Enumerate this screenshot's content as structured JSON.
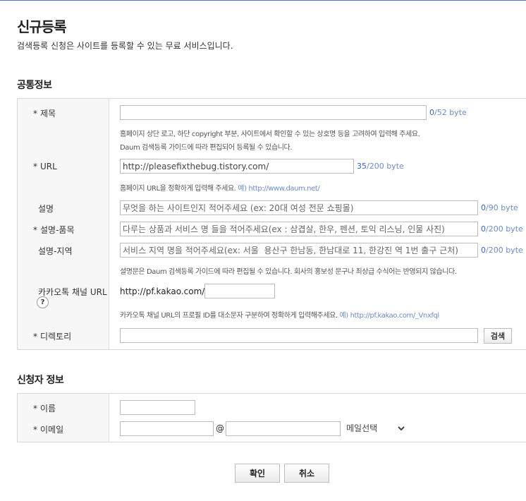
{
  "page": {
    "title": "신규등록",
    "description": "검색등록 신청은 사이트를 등록할 수 있는 무료 서비스입니다."
  },
  "common": {
    "section_title": "공통정보",
    "title_field": {
      "label": "제목",
      "value": "",
      "count": "0",
      "limit": "/52 byte"
    },
    "title_help_1": "홈페이지 상단 로고, 하단 copyright 부분, 사이트에서 확인할 수 있는 상호명 등을 고려하여 입력해 주세요.",
    "title_help_2": "Daum 검색등록 가이드에 따라 편집되어 등록될 수 있습니다.",
    "url_field": {
      "label": "URL",
      "value": "http://pleasefixthebug.tistory.com/",
      "count": "35",
      "limit": "/200 byte"
    },
    "url_help": "홈페이지 URL을 정확하게 입력해 주세요.",
    "url_help_example": "예) http://www.daum.net/",
    "desc_field": {
      "label": "설명",
      "placeholder": "무엇을 하는 사이트인지 적어주세요 (ex: 20대 여성 전문 쇼핑몰)",
      "count": "0",
      "limit": "/90 byte"
    },
    "desc_product_field": {
      "label": "설명-품목",
      "placeholder": "다루는 상품과 서비스 명 들을 적어주세요(ex : 삼겹살, 한우, 펜션, 토익 리스닝, 인물 사진)",
      "count": "0",
      "limit": "/200 byte"
    },
    "desc_region_field": {
      "label": "설명-지역",
      "placeholder": "서비스 지역 명을 적어주세요(ex: 서울  용산구 한남동, 한남대로 11, 한강진 역 1번 출구 근처)",
      "count": "0",
      "limit": "/200 byte"
    },
    "desc_help": "설명문은 Daum 검색등록 가이드에 따라 편집될 수 있습니다. 회사의 홍보성 문구나 최상급 수식어는 반영되지 않습니다.",
    "kakao_field": {
      "label": "카카오톡 채널 URL",
      "help_glyph": "?",
      "prefix": "http://pf.kakao.com/",
      "value": ""
    },
    "kakao_help": "카카오톡 채널 URL의 프로필 ID를 대소문자 구분하여 정확하게 입력해주세요.",
    "kakao_help_example": "예) http://pf.kakao.com/_Vnxfql",
    "directory_field": {
      "label": "디렉토리",
      "value": "",
      "search_button": "검색"
    }
  },
  "applicant": {
    "section_title": "신청자 정보",
    "name_field": {
      "label": "이름",
      "value": ""
    },
    "email_field": {
      "label": "이메일",
      "local_value": "",
      "at": "@",
      "domain_value": "",
      "select_value": "메일선택"
    }
  },
  "required_mark": "*",
  "actions": {
    "confirm": "확인",
    "cancel": "취소"
  },
  "colors": {
    "accent_line": "#4b74d4",
    "link": "#6f8cc6",
    "count_highlight": "#3c66c0"
  }
}
